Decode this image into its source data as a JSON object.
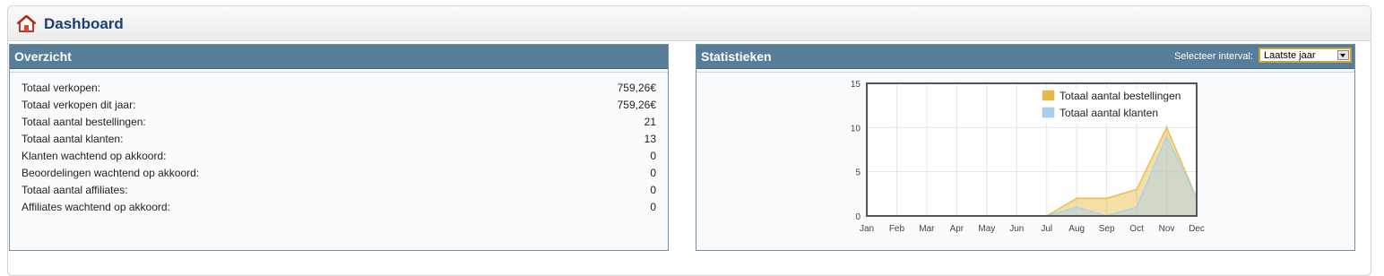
{
  "header": {
    "title": "Dashboard",
    "icon": "home-icon"
  },
  "overview": {
    "title": "Overzicht",
    "rows": [
      {
        "label": "Totaal verkopen:",
        "value": "759,26€"
      },
      {
        "label": "Totaal verkopen dit jaar:",
        "value": "759,26€"
      },
      {
        "label": "Totaal aantal bestellingen:",
        "value": "21"
      },
      {
        "label": "Totaal aantal klanten:",
        "value": "13"
      },
      {
        "label": "Klanten wachtend op akkoord:",
        "value": "0"
      },
      {
        "label": "Beoordelingen wachtend op akkoord:",
        "value": "0"
      },
      {
        "label": "Totaal aantal affiliates:",
        "value": "0"
      },
      {
        "label": "Affiliates wachtend op akkoord:",
        "value": "0"
      }
    ]
  },
  "stats": {
    "title": "Statistieken",
    "interval_label": "Selecteer interval:",
    "interval_value": "Laatste jaar"
  },
  "chart_data": {
    "type": "area",
    "categories": [
      "Jan",
      "Feb",
      "Mar",
      "Apr",
      "May",
      "Jun",
      "Jul",
      "Aug",
      "Sep",
      "Oct",
      "Nov",
      "Dec"
    ],
    "series": [
      {
        "name": "Totaal aantal bestellingen",
        "color": "#e8b93f",
        "values": [
          0,
          0,
          0,
          0,
          0,
          0,
          0,
          2,
          2,
          3,
          10,
          2
        ]
      },
      {
        "name": "Totaal aantal klanten",
        "color": "#a8d0ef",
        "values": [
          0,
          0,
          0,
          0,
          0,
          0,
          0,
          1,
          0,
          1,
          9,
          2
        ]
      }
    ],
    "ylim": [
      0,
      15
    ],
    "yticks": [
      0,
      5,
      10,
      15
    ],
    "grid": true,
    "legend": "top-right"
  }
}
